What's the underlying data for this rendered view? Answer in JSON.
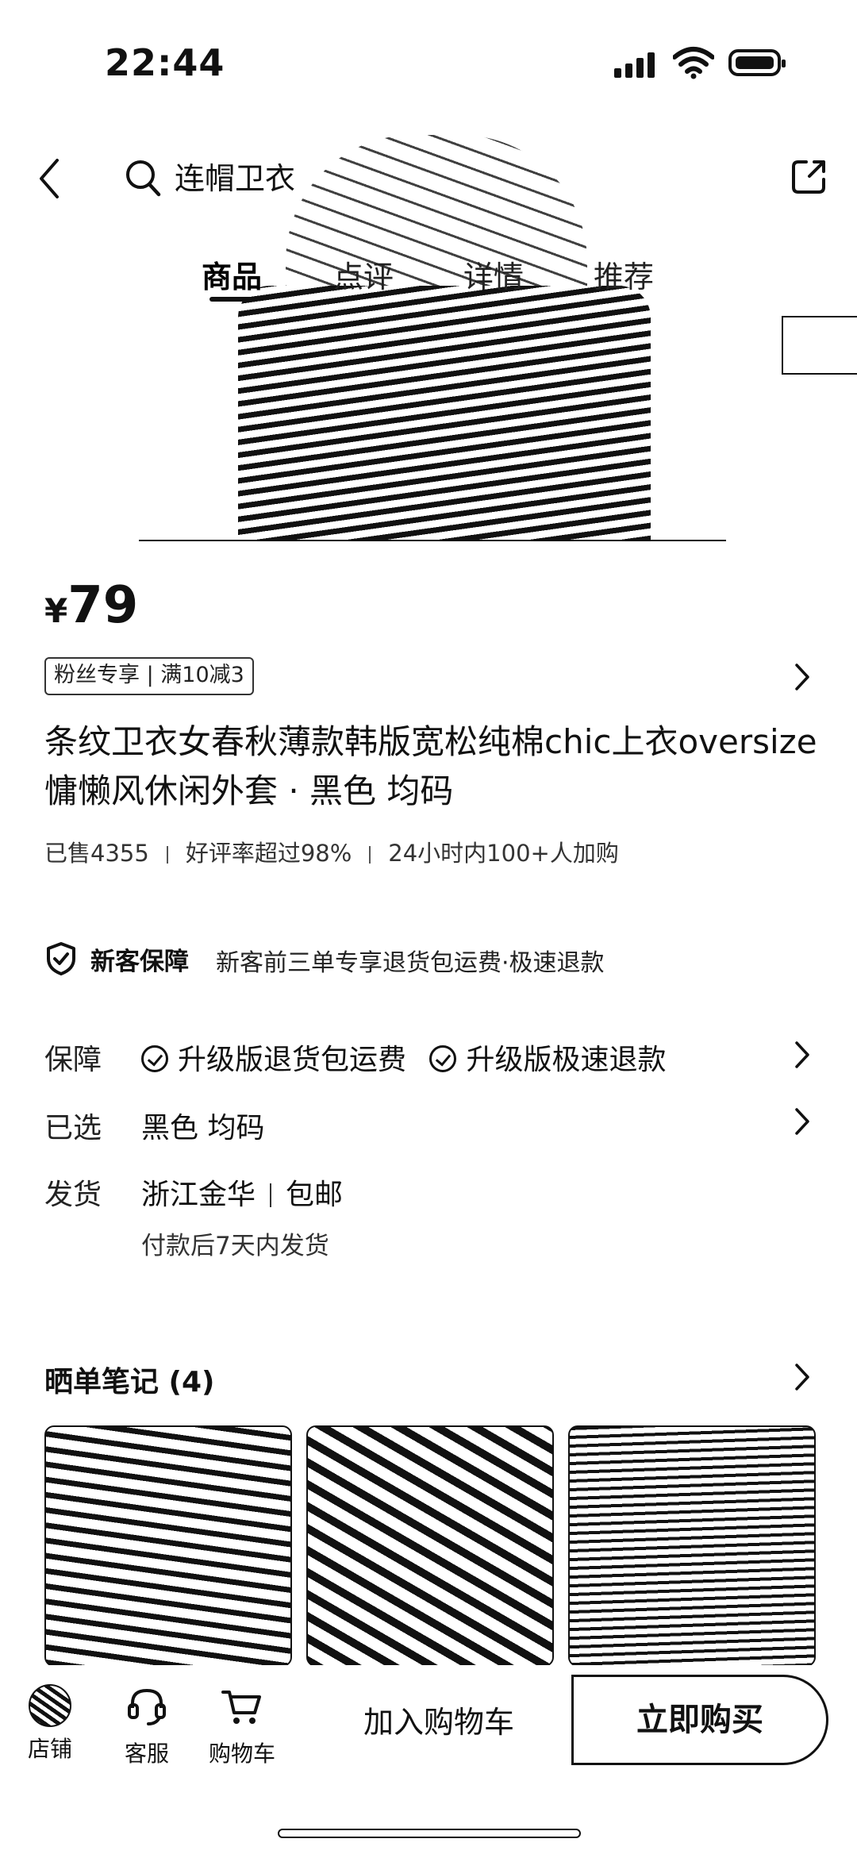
{
  "status_bar": {
    "time": "22:44"
  },
  "nav": {
    "search_text": "连帽卫衣"
  },
  "tabs": [
    {
      "label": "商品",
      "active": true
    },
    {
      "label": "点评"
    },
    {
      "label": "详情"
    },
    {
      "label": "推荐"
    }
  ],
  "product": {
    "currency": "¥",
    "price": "79",
    "coupon": "粉丝专享 | 满10减3",
    "title": "条纹卫衣女春秋薄款韩版宽松纯棉chic上衣oversize慵懒风休闲外套 · 黑色 均码",
    "sold": "已售4355",
    "rating": "好评率超过98%",
    "cart_adds": "24小时内100+人加购"
  },
  "guarantee": {
    "label": "新客保障",
    "desc": "新客前三单专享退货包运费·极速退款"
  },
  "rows": {
    "baozhang_label": "保障",
    "baozhang_item1": "升级版退货包运费",
    "baozhang_item2": "升级版极速退款",
    "selected_label": "已选",
    "selected_value": "黑色 均码",
    "ship_label": "发货",
    "ship_origin": "浙江金华",
    "ship_fee": "包邮",
    "ship_note": "付款后7天内发货"
  },
  "notes": {
    "title": "晒单笔记 (4)"
  },
  "bottom_bar": {
    "shop": "店铺",
    "service": "客服",
    "cart": "购物车",
    "add_to_cart": "加入购物车",
    "buy_now": "立即购买"
  }
}
